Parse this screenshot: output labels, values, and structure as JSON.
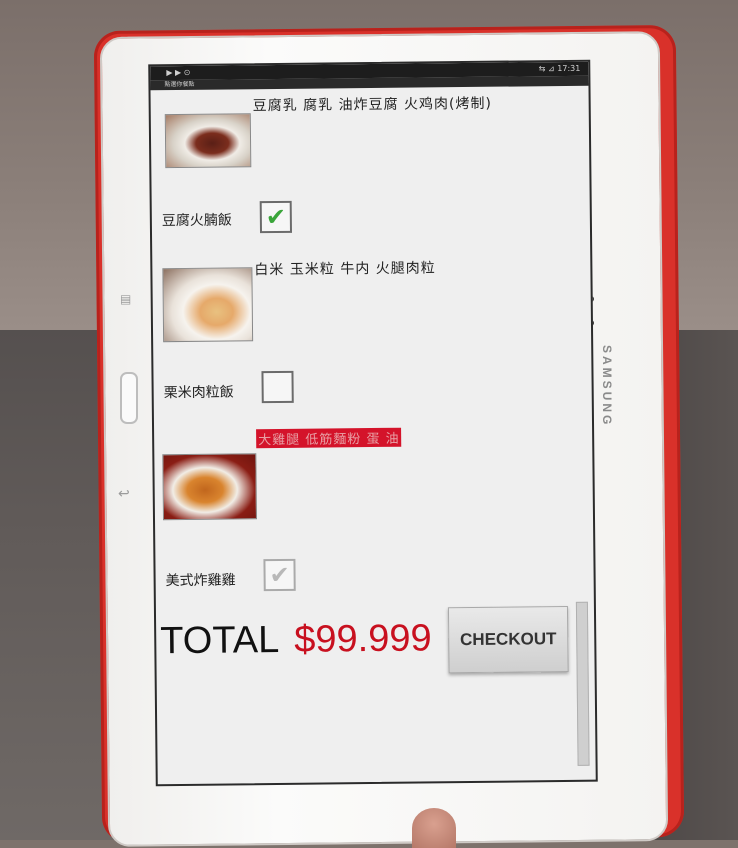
{
  "status_bar": {
    "left": "▶ ▶ ⊙",
    "right": "⇆ ⊿ 17:31"
  },
  "app_title": "點選你餐點",
  "menu": [
    {
      "name": "豆腐火腩飯",
      "ingredients": "豆腐乳 腐乳 油炸豆腐 火鸡肉(烤制)",
      "checked": true,
      "highlighted": false
    },
    {
      "name": "栗米肉粒飯",
      "ingredients": "白米 玉米粒  牛内 火腿肉粒",
      "checked": false,
      "highlighted": false
    },
    {
      "name": "美式炸雞雞",
      "ingredients": "大雞腿 低筋麵粉 蛋  油",
      "checked": true,
      "disabled": true,
      "highlighted": true
    }
  ],
  "total": {
    "label": "TOTAL",
    "value": "$99.999"
  },
  "checkout_label": "CHECKOUT",
  "device": {
    "brand": "SAMSUNG"
  },
  "colors": {
    "case": "#d9312a",
    "total_value": "#c8101f",
    "highlight": "#d4132a",
    "check": "#3aa53a"
  }
}
